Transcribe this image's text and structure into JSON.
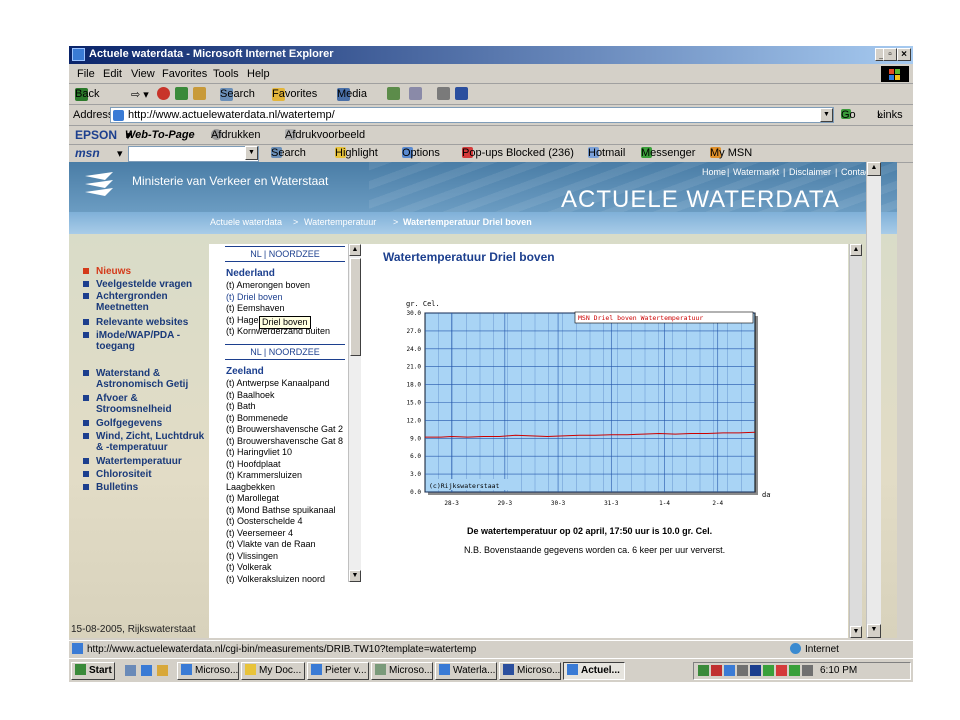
{
  "window": {
    "title": "Actuele waterdata - Microsoft Internet Explorer"
  },
  "menu": {
    "items": [
      "File",
      "Edit",
      "View",
      "Favorites",
      "Tools",
      "Help"
    ]
  },
  "toolbar": {
    "back": "Back",
    "search": "Search",
    "favorites": "Favorites",
    "media": "Media"
  },
  "address": {
    "label": "Address",
    "url": "http://www.actuelewaterdata.nl/watertemp/",
    "go": "Go",
    "links": "Links"
  },
  "epson": {
    "brand": "EPSON",
    "web_to_page": "Web-To-Page",
    "afdrukken": "Afdrukken",
    "voorbeeld": "Afdrukvoorbeeld"
  },
  "msn": {
    "brand": "msn",
    "search": "Search",
    "highlight": "Highlight",
    "options": "Options",
    "popups": "Pop-ups Blocked (236)",
    "hotmail": "Hotmail",
    "messenger": "Messenger",
    "mymsn": "My MSN"
  },
  "site": {
    "ministry": "Ministerie van Verkeer en Waterstaat",
    "topnav": [
      "Home",
      "Watermarkt",
      "Disclaimer",
      "Contact"
    ],
    "banner_title": "ACTUELE WATERDATA",
    "breadcrumb": {
      "a": "Actuele waterdata",
      "b": "Watertemperatuur",
      "c": "Watertemperatuur Driel boven"
    },
    "nav": [
      {
        "label": "Nieuws"
      },
      {
        "label": "Veelgestelde vragen"
      },
      {
        "label": "Achtergronden Meetnetten"
      },
      {
        "label": "Relevante websites"
      },
      {
        "label": "iMode/WAP/PDA - toegang"
      },
      {
        "label": "Waterstand & Astronomisch Getij"
      },
      {
        "label": "Afvoer & Stroomsnelheid"
      },
      {
        "label": "Golfgegevens"
      },
      {
        "label": "Wind, Zicht, Luchtdruk & -temperatuur"
      },
      {
        "label": "Watertemperatuur"
      },
      {
        "label": "Chlorositeit"
      },
      {
        "label": "Bulletins"
      }
    ],
    "footer": "15-08-2005, Rijkswaterstaat",
    "tabs": {
      "nl": "NL",
      "sep": "|",
      "noordzee": "NOORDZEE"
    },
    "regions": [
      {
        "name": "Nederland",
        "items": [
          "(t) Amerongen boven",
          "(t) Driel boven",
          "(t) Eemshaven",
          "(t) Hagestein boven",
          "(t) Kornwerderzand buiten"
        ]
      },
      {
        "name": "Zeeland",
        "items": [
          "(t) Antwerpse Kanaalpand",
          "(t) Baalhoek",
          "(t) Bath",
          "(t) Bommenede",
          "(t) Brouwershavensche Gat 2",
          "(t) Brouwershavensche Gat 8",
          "(t) Haringvliet 10",
          "(t) Hoofdplaat",
          "(t) Krammersluizen",
          "Laagbekken",
          "(t) Marollegat",
          "(t) Mond Bathse spuikanaal",
          "(t) Oosterschelde 4",
          "(t) Veersemeer 4",
          "(t) Vlakte van de Raan",
          "(t) Vlissingen",
          "(t) Volkerak",
          "(t) Volkeraksluizen noord"
        ]
      }
    ],
    "tooltip": "Driel boven",
    "page_title": "Watertemperatuur Driel boven",
    "caption": "De watertemperatuur op 02 april, 17:50 uur is 10.0 gr. Cel.",
    "note": "N.B. Bovenstaande gegevens worden ca. 6 keer per uur ververst."
  },
  "chart_data": {
    "type": "line",
    "ylabel": "gr. Cel.",
    "xlabel": "datum",
    "legend": "MSN Driel boven Watertemperatuur",
    "credit": "(c)Rijkswaterstaat",
    "ylim": [
      0,
      30
    ],
    "yticks": [
      "0.0",
      "3.0",
      "6.0",
      "9.0",
      "12.0",
      "15.0",
      "18.0",
      "21.0",
      "24.0",
      "27.0",
      "30.0"
    ],
    "xticks": [
      "28-3",
      "29-3",
      "30-3",
      "31-3",
      "1-4",
      "2-4"
    ],
    "xlim": [
      27.5,
      33.7
    ],
    "series": [
      {
        "name": "MSN Driel boven Watertemperatuur",
        "color": "#cc0000",
        "x": [
          27.5,
          27.8,
          28.0,
          28.3,
          28.6,
          28.9,
          29.2,
          29.5,
          29.8,
          30.1,
          30.4,
          30.7,
          31.0,
          31.3,
          31.6,
          31.9,
          32.2,
          32.5,
          32.8,
          33.1,
          33.4,
          33.7
        ],
        "y": [
          9.2,
          9.2,
          9.3,
          9.2,
          9.3,
          9.3,
          9.5,
          9.4,
          9.3,
          9.4,
          9.5,
          9.5,
          9.6,
          9.6,
          9.7,
          9.8,
          9.7,
          9.8,
          9.8,
          9.9,
          9.9,
          10.0
        ]
      }
    ],
    "colors": {
      "plot_bg": "#a9d4f5",
      "grid": "#2255aa",
      "legend_text": "#cc0000"
    }
  },
  "statusbar": {
    "url": "http://www.actuelewaterdata.nl/cgi-bin/measurements/DRIB.TW10?template=watertemp",
    "zone": "Internet"
  },
  "taskbar": {
    "start": "Start",
    "tasks": [
      "Microso...",
      "My Doc...",
      "Pieter v...",
      "Microso...",
      "Waterla...",
      "Microso...",
      "Actuel..."
    ],
    "clock": "6:10 PM"
  }
}
